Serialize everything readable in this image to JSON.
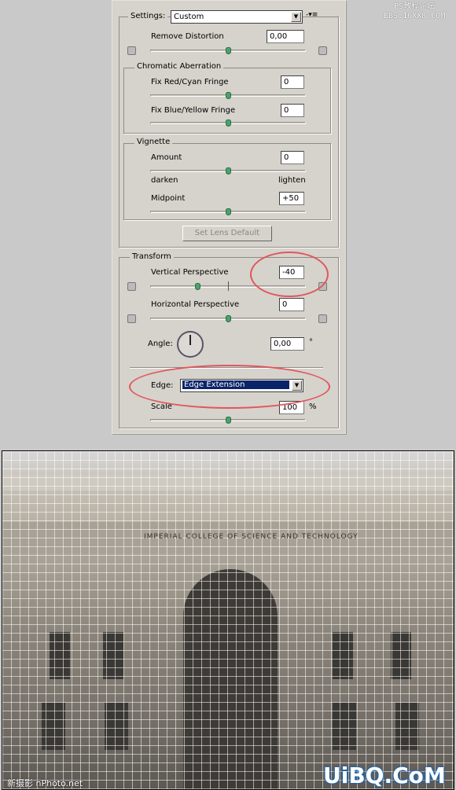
{
  "watermark_top": {
    "line1": "PS教程论坛",
    "line2": "BBS.16XX8.COM"
  },
  "settings": {
    "label": "Settings:",
    "value": "Custom",
    "menu_icon": "flyout-menu-icon"
  },
  "remove_distortion": {
    "label": "Remove Distortion",
    "value": "0,00",
    "slider": 0
  },
  "chromatic": {
    "title": "Chromatic Aberration",
    "red_cyan": {
      "label": "Fix Red/Cyan Fringe",
      "value": "0",
      "slider": 0
    },
    "blue_yellow": {
      "label": "Fix Blue/Yellow Fringe",
      "value": "0",
      "slider": 0
    }
  },
  "vignette": {
    "title": "Vignette",
    "amount": {
      "label": "Amount",
      "value": "0",
      "slider": 0,
      "left": "darken",
      "right": "lighten"
    },
    "midpoint": {
      "label": "Midpoint",
      "value": "+50",
      "slider": 50
    }
  },
  "set_lens_default": "Set Lens Default",
  "transform": {
    "title": "Transform",
    "vertical": {
      "label": "Vertical Perspective",
      "value": "-40",
      "slider": -40
    },
    "horizontal": {
      "label": "Horizontal Perspective",
      "value": "0",
      "slider": 0
    },
    "angle": {
      "label": "Angle:",
      "value": "0,00",
      "unit": "°"
    },
    "edge": {
      "label": "Edge:",
      "value": "Edge Extension"
    },
    "scale": {
      "label": "Scale",
      "value": "100",
      "unit": "%",
      "slider": 100
    }
  },
  "colors": {
    "highlight_ring": "#e0575c",
    "selection": "#0a246a",
    "slider_thumb": "#4aa36a"
  },
  "photo": {
    "facade_text": "IMPERIAL COLLEGE OF SCIENCE AND TECHNOLOGY"
  },
  "watermark_bottom_left": "新摄影 nPhoto.net",
  "watermark_bottom_right": "UiBQ.CoM"
}
